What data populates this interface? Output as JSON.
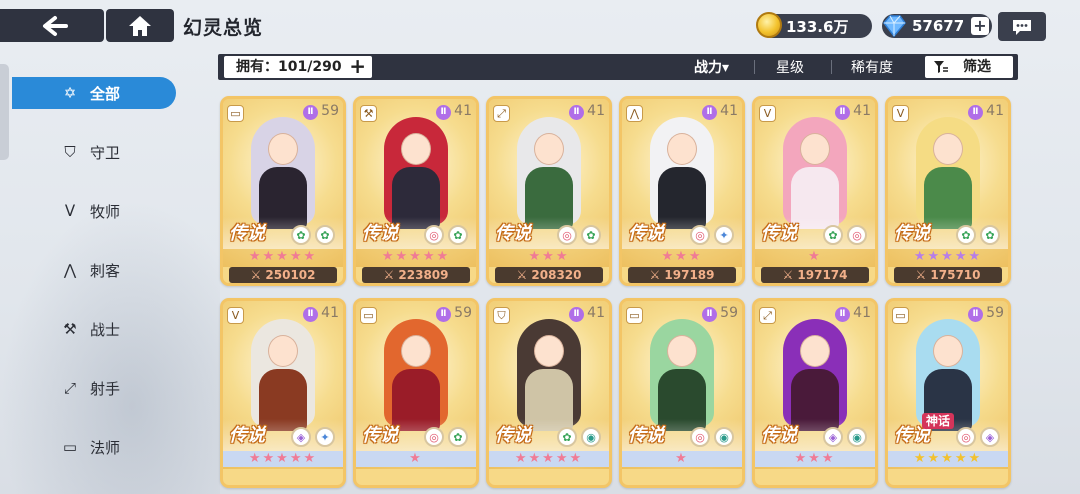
{
  "header": {
    "title": "幻灵总览",
    "back_icon": "back-arrow-icon",
    "home_icon": "home-icon"
  },
  "resources": {
    "gold": "133.6万",
    "gems": "57677",
    "gems_add": "+"
  },
  "filter_bar": {
    "owned_label": "拥有：101/290",
    "owned_add": "+",
    "tabs": [
      "战力▾",
      "星级",
      "稀有度"
    ],
    "filter_label": "筛选"
  },
  "sidebar": {
    "items": [
      {
        "label": "全部",
        "icon": "star-all-icon",
        "active": true
      },
      {
        "label": "守卫",
        "icon": "shield-icon"
      },
      {
        "label": "牧师",
        "icon": "wing-icon"
      },
      {
        "label": "刺客",
        "icon": "claw-icon"
      },
      {
        "label": "战士",
        "icon": "axe-icon"
      },
      {
        "label": "射手",
        "icon": "bow-icon"
      },
      {
        "label": "法师",
        "icon": "book-icon"
      }
    ]
  },
  "cards": [
    {
      "rarity": "传说",
      "level": "59",
      "class_icon": "book-icon",
      "elements": [
        "wind",
        "wind"
      ],
      "stars": "★★★★★",
      "star_color": "#f07b95",
      "power": "250102",
      "hair": "#d8d3e6",
      "outfit": "#2a2430"
    },
    {
      "rarity": "传说",
      "level": "41",
      "class_icon": "axe-icon",
      "elements": [
        "fire",
        "wind"
      ],
      "stars": "★★★★★",
      "star_color": "#f07b95",
      "power": "223809",
      "hair": "#c8283a",
      "outfit": "#2d2a3a"
    },
    {
      "rarity": "传说",
      "level": "41",
      "class_icon": "bow-icon",
      "elements": [
        "fire",
        "wind"
      ],
      "stars": "★★★",
      "star_color": "#f07b95",
      "power": "208320",
      "hair": "#e8e8ea",
      "outfit": "#3a6b3e"
    },
    {
      "rarity": "传说",
      "level": "41",
      "class_icon": "claw-icon",
      "elements": [
        "fire",
        "ice"
      ],
      "stars": "★★★",
      "star_color": "#f07b95",
      "power": "197189",
      "hair": "#f2f2f4",
      "outfit": "#24262e"
    },
    {
      "rarity": "传说",
      "level": "41",
      "class_icon": "wing-icon",
      "elements": [
        "wind",
        "fire"
      ],
      "stars": "★",
      "star_color": "#f07b95",
      "power": "197174",
      "hair": "#f3a6bd",
      "outfit": "#f6e8ef"
    },
    {
      "rarity": "传说",
      "level": "41",
      "class_icon": "wing-icon",
      "elements": [
        "wind",
        "wind"
      ],
      "stars": "★★★★★",
      "star_color": "#b67ee8",
      "power": "175710",
      "hair": "#f5dc84",
      "outfit": "#4b8a4a"
    },
    {
      "rarity": "传说",
      "level": "41",
      "class_icon": "wing-icon",
      "elements": [
        "light",
        "ice"
      ],
      "stars": "★★★★★",
      "star_color": "#f07b95",
      "power": "",
      "hair": "#ebe7e0",
      "outfit": "#8a3a22"
    },
    {
      "rarity": "传说",
      "level": "59",
      "class_icon": "book-icon",
      "elements": [
        "fire",
        "wind"
      ],
      "stars": "★",
      "star_color": "#f07b95",
      "power": "",
      "hair": "#e2672e",
      "outfit": "#9a1c28"
    },
    {
      "rarity": "传说",
      "level": "41",
      "class_icon": "shield-icon",
      "elements": [
        "wind",
        "water"
      ],
      "stars": "★★★★★",
      "star_color": "#f07b95",
      "power": "",
      "hair": "#4a3a34",
      "outfit": "#cfc4a6"
    },
    {
      "rarity": "传说",
      "level": "59",
      "class_icon": "book-icon",
      "elements": [
        "fire",
        "water"
      ],
      "stars": "★",
      "star_color": "#f07b95",
      "power": "",
      "hair": "#9ad6a0",
      "outfit": "#2a4a2e"
    },
    {
      "rarity": "传说",
      "level": "41",
      "class_icon": "bow-icon",
      "elements": [
        "light",
        "water"
      ],
      "stars": "★★★",
      "star_color": "#f07b95",
      "power": "",
      "hair": "#8a2fb8",
      "outfit": "#4a1a3a"
    },
    {
      "rarity": "传说",
      "myth": "神话",
      "level": "59",
      "class_icon": "book-icon",
      "elements": [
        "fire",
        "light"
      ],
      "stars": "★★★★★",
      "star_color": "#f2c12e",
      "power": "",
      "hair": "#a9dcf0",
      "outfit": "#2a3446"
    }
  ]
}
